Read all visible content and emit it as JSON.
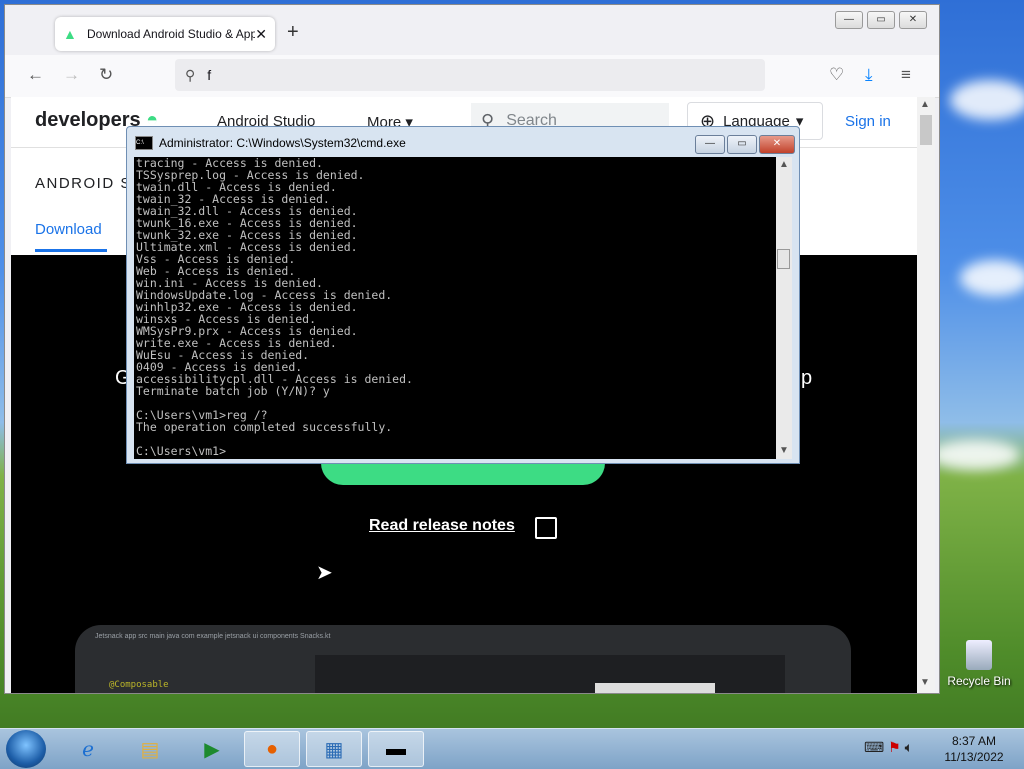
{
  "browser": {
    "tab_title": "Download Android Studio & App",
    "tab_close": "✕",
    "new_tab": "+",
    "url_text": "f",
    "window_buttons": [
      "—",
      "▭",
      "✕"
    ]
  },
  "site": {
    "logo_text": "developers",
    "nav": [
      "Android Studio",
      "More"
    ],
    "search_placeholder": "Search",
    "language_label": "Language",
    "signin_label": "Sign in",
    "subhead": "ANDROID S",
    "tab_download": "Download",
    "hero_left_char": "G",
    "hero_right_char": "p",
    "release_notes": "Read release notes",
    "ide_toolbar": "Jetsnack  app  src  main  java  com  example  jetsnack  ui  components  Snacks.kt",
    "ide_code": "@Composable"
  },
  "cmd": {
    "title": "Administrator: C:\\Windows\\System32\\cmd.exe",
    "output": "tracing - Access is denied.\nTSSysprep.log - Access is denied.\ntwain.dll - Access is denied.\ntwain_32 - Access is denied.\ntwain_32.dll - Access is denied.\ntwunk_16.exe - Access is denied.\ntwunk_32.exe - Access is denied.\nUltimate.xml - Access is denied.\nVss - Access is denied.\nWeb - Access is denied.\nwin.ini - Access is denied.\nWindowsUpdate.log - Access is denied.\nwinhlp32.exe - Access is denied.\nwinsxs - Access is denied.\nWMSysPr9.prx - Access is denied.\nwrite.exe - Access is denied.\nWuEsu - Access is denied.\n0409 - Access is denied.\naccessibilitycpl.dll - Access is denied.\nTerminate batch job (Y/N)? y\n\nC:\\Users\\vm1>reg /?\nThe operation completed successfully.\n\nC:\\Users\\vm1>"
  },
  "desktop": {
    "recycle_bin": "Recycle Bin"
  },
  "taskbar": {
    "time": "8:37 AM",
    "date": "11/13/2022"
  },
  "colors": {
    "accent_green": "#3ddc84",
    "link_blue": "#1a73e8"
  }
}
